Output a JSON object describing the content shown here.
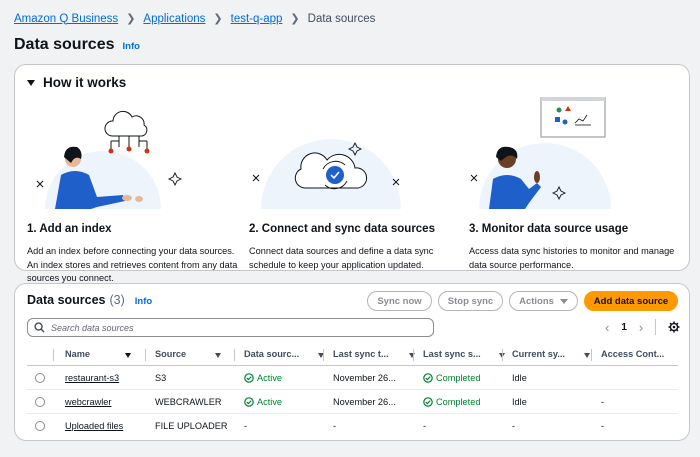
{
  "breadcrumb": {
    "items": [
      "Amazon Q Business",
      "Applications",
      "test-q-app",
      "Data sources"
    ]
  },
  "page": {
    "title": "Data sources",
    "info": "Info"
  },
  "how_it_works": {
    "title": "How it works",
    "steps": [
      {
        "title": "1. Add an index",
        "description": "Add an index before connecting your data sources. An index stores and retrieves content from any data sources you connect."
      },
      {
        "title": "2. Connect and sync data sources",
        "description": "Connect data sources and define a data sync schedule to keep your application updated."
      },
      {
        "title": "3. Monitor data source usage",
        "description": "Access data sync histories to monitor and manage data source performance."
      }
    ]
  },
  "data_sources": {
    "title": "Data sources",
    "count": "(3)",
    "info": "Info",
    "buttons": {
      "sync_now": "Sync now",
      "stop_sync": "Stop sync",
      "actions": "Actions",
      "add": "Add data source"
    },
    "search_placeholder": "Search data sources",
    "pagination": {
      "page": "1"
    },
    "columns": [
      "Name",
      "Source",
      "Data sourc...",
      "Last sync t...",
      "Last sync s...",
      "Current sy...",
      "Access Cont..."
    ],
    "rows": [
      {
        "name": "restaurant-s3",
        "source": "S3",
        "data_source_status": "Active",
        "last_sync_time": "November 26...",
        "last_sync_status": "Completed",
        "current_sync": "Idle",
        "access_control": ""
      },
      {
        "name": "webcrawler",
        "source": "WEBCRAWLER",
        "data_source_status": "Active",
        "last_sync_time": "November 26...",
        "last_sync_status": "Completed",
        "current_sync": "Idle",
        "access_control": "-"
      },
      {
        "name": "Uploaded files",
        "source": "FILE UPLOADER",
        "data_source_status": "-",
        "last_sync_time": "-",
        "last_sync_status": "-",
        "current_sync": "-",
        "access_control": "-"
      }
    ]
  },
  "colors": {
    "link": "#006ce0",
    "primary_button": "#ff9900",
    "success": "#00802f",
    "illustration_bg": "#eef4fc",
    "person_blue": "#1f5fc9"
  },
  "icons": [
    "chevron-right-icon",
    "caret-down-icon",
    "search-icon",
    "chevron-left-icon",
    "gear-icon",
    "check-circle-icon",
    "sort-caret-icon"
  ]
}
